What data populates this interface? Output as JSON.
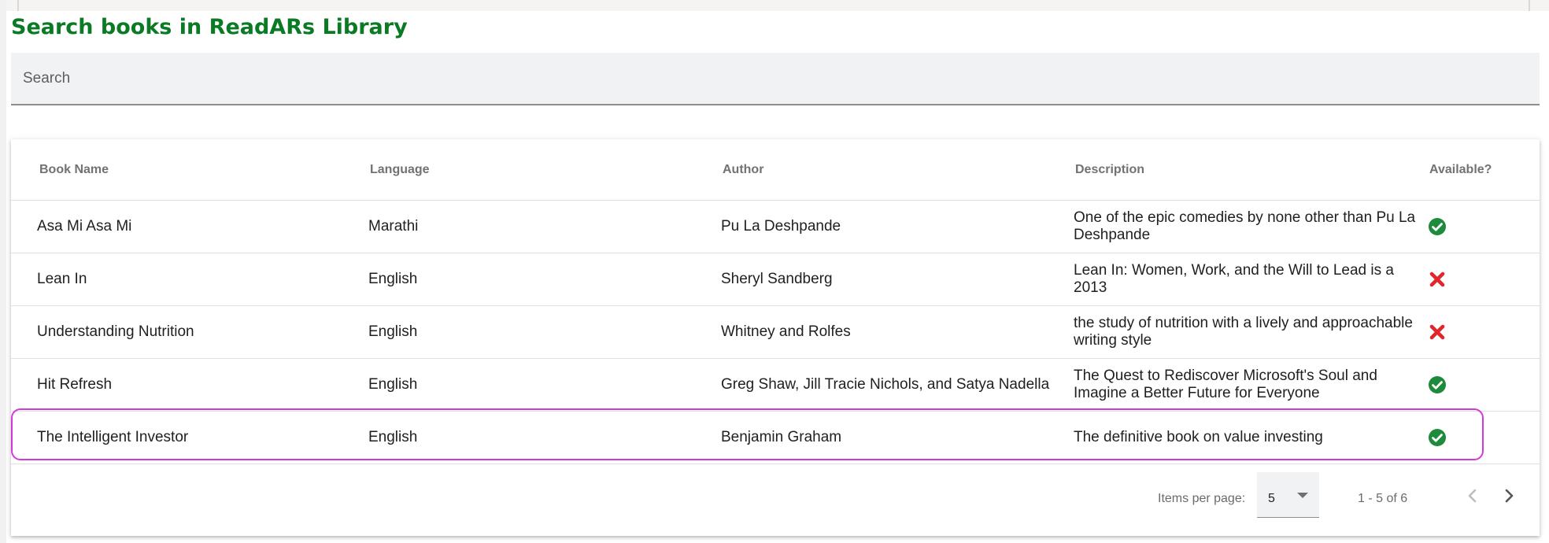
{
  "page": {
    "title": "Search books in ReadARs Library"
  },
  "search": {
    "placeholder": "Search",
    "value": ""
  },
  "table": {
    "headers": {
      "name": "Book Name",
      "language": "Language",
      "author": "Author",
      "description": "Description",
      "available": "Available?"
    },
    "rows": [
      {
        "name": "Asa Mi Asa Mi",
        "language": "Marathi",
        "author": "Pu La Deshpande",
        "description": "One of the epic comedies by none other than Pu La Deshpande",
        "available": true,
        "available_icon": "check-circle-icon"
      },
      {
        "name": "Lean In",
        "language": "English",
        "author": "Sheryl Sandberg",
        "description": "Lean In: Women, Work, and the Will to Lead is a 2013",
        "available": false,
        "available_icon": "close-icon"
      },
      {
        "name": "Understanding Nutrition",
        "language": "English",
        "author": "Whitney and Rolfes",
        "description": "the study of nutrition with a lively and approachable writing style",
        "available": false,
        "available_icon": "close-icon"
      },
      {
        "name": "Hit Refresh",
        "language": "English",
        "author": "Greg Shaw, Jill Tracie Nichols, and Satya Nadella",
        "description": "The Quest to Rediscover Microsoft's Soul and Imagine a Better Future for Everyone",
        "available": true,
        "available_icon": "check-circle-icon"
      },
      {
        "name": "The Intelligent Investor",
        "language": "English",
        "author": "Benjamin Graham",
        "description": "The definitive book on value investing",
        "available": true,
        "available_icon": "check-circle-icon"
      }
    ]
  },
  "paginator": {
    "items_per_page_label": "Items per page:",
    "items_per_page_value": "5",
    "range_label": "1 - 5 of 6",
    "prev_icon": "chevron-left-icon",
    "next_icon": "chevron-right-icon"
  },
  "colors": {
    "title": "#0a7a25",
    "available_yes": "#1e8a3c",
    "available_no": "#e0262b",
    "highlight": "#d23ad8"
  }
}
